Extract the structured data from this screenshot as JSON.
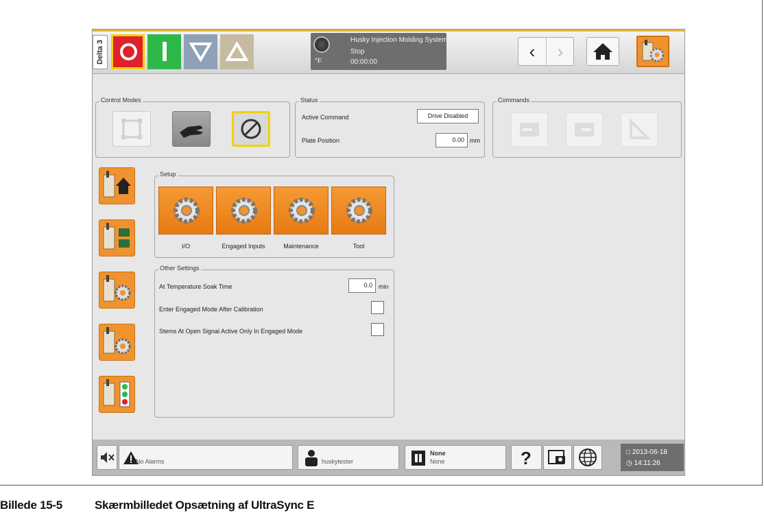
{
  "topbar": {
    "unit_label": "Delta 3",
    "temp_unit": "°F",
    "company": "Husky Injection Molding Systems",
    "state": "Stop",
    "timer": "00:00:00"
  },
  "control_modes": {
    "legend": "Control Modes",
    "selected": "disabled"
  },
  "status": {
    "legend": "Status",
    "active_command_label": "Active Command",
    "active_command_value": "Drive Disabled",
    "plate_position_label": "Plate Position",
    "plate_position_value": "0.00",
    "plate_position_unit": "mm"
  },
  "commands": {
    "legend": "Commands"
  },
  "setup": {
    "legend": "Setup",
    "buttons": [
      {
        "label": "I/O"
      },
      {
        "label": "Engaged Inputs"
      },
      {
        "label": "Maintenance"
      },
      {
        "label": "Tool"
      }
    ]
  },
  "other_settings": {
    "legend": "Other Settings",
    "soak_label": "At Temperature Soak Time",
    "soak_value": "0.0",
    "soak_unit": "min",
    "engaged_after_cal_label": "Enter Engaged Mode After Calibration",
    "engaged_after_cal_checked": false,
    "stems_open_label": "Stems At Open Signal Active Only In Engaged Mode",
    "stems_open_checked": false
  },
  "bottombar": {
    "alarms": "No Alarms",
    "user": "huskytester",
    "mold_name": "None",
    "mold_sub": "None",
    "date": "2013-06-18",
    "time": "14:11:26"
  },
  "caption": {
    "number": "Billede 15-5",
    "title": "Skærmbilledet Opsætning af UltraSync E"
  },
  "colors": {
    "orange": "#f0932e",
    "stop_red": "#e0202a",
    "start_green": "#2eb84a",
    "highlight_yellow": "#f0d200"
  }
}
